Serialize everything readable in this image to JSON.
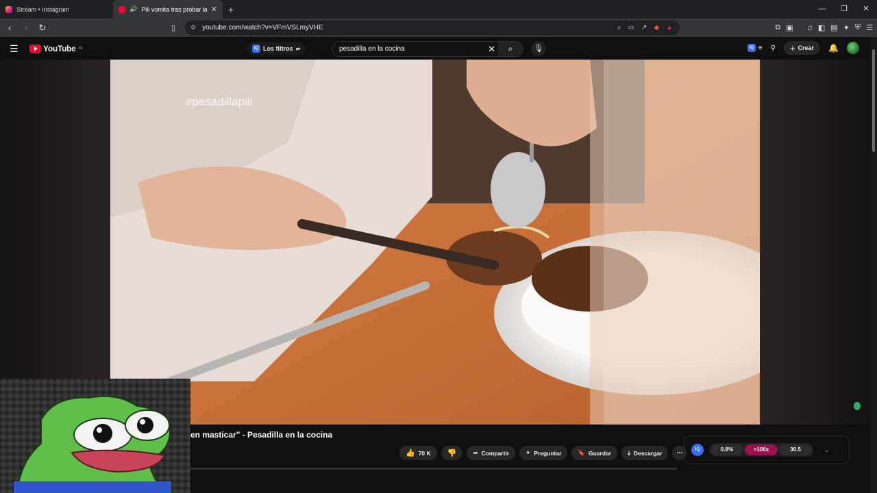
{
  "browser": {
    "tabs": [
      {
        "title": "Stream • Instagram",
        "icon": "instagram-icon",
        "active": false
      },
      {
        "title": "Pili vomita tras probar la com",
        "icon": "youtube-icon",
        "active": true
      }
    ],
    "new_tab_label": "+",
    "url": "youtube.com/watch?v=VFmVSLmyVHE",
    "window_controls": {
      "minimize": "—",
      "restore": "❐",
      "close": "✕"
    }
  },
  "youtube": {
    "logo_text": "YouTube",
    "country_code": "PE",
    "filters_label": "Los filtros",
    "search_value": "pesadilla en la cocina",
    "create_label": "Crear"
  },
  "video": {
    "overlay_hashtag": "#pesadillapili",
    "title_visible": "en masticar\" - Pesadilla en la cocina",
    "likes": "70 K",
    "actions": {
      "share": "Compartir",
      "ask": "Preguntar",
      "save": "Guardar",
      "download": "Descargar",
      "more": "⋯"
    }
  },
  "iq_panel": {
    "badge": "IQ",
    "values": [
      "0.8%",
      ">100x",
      "30.5"
    ],
    "accent": "#9c1150"
  },
  "colors": {
    "youtube_red": "#ff0033",
    "iq_blue": "#3b6fe8"
  }
}
